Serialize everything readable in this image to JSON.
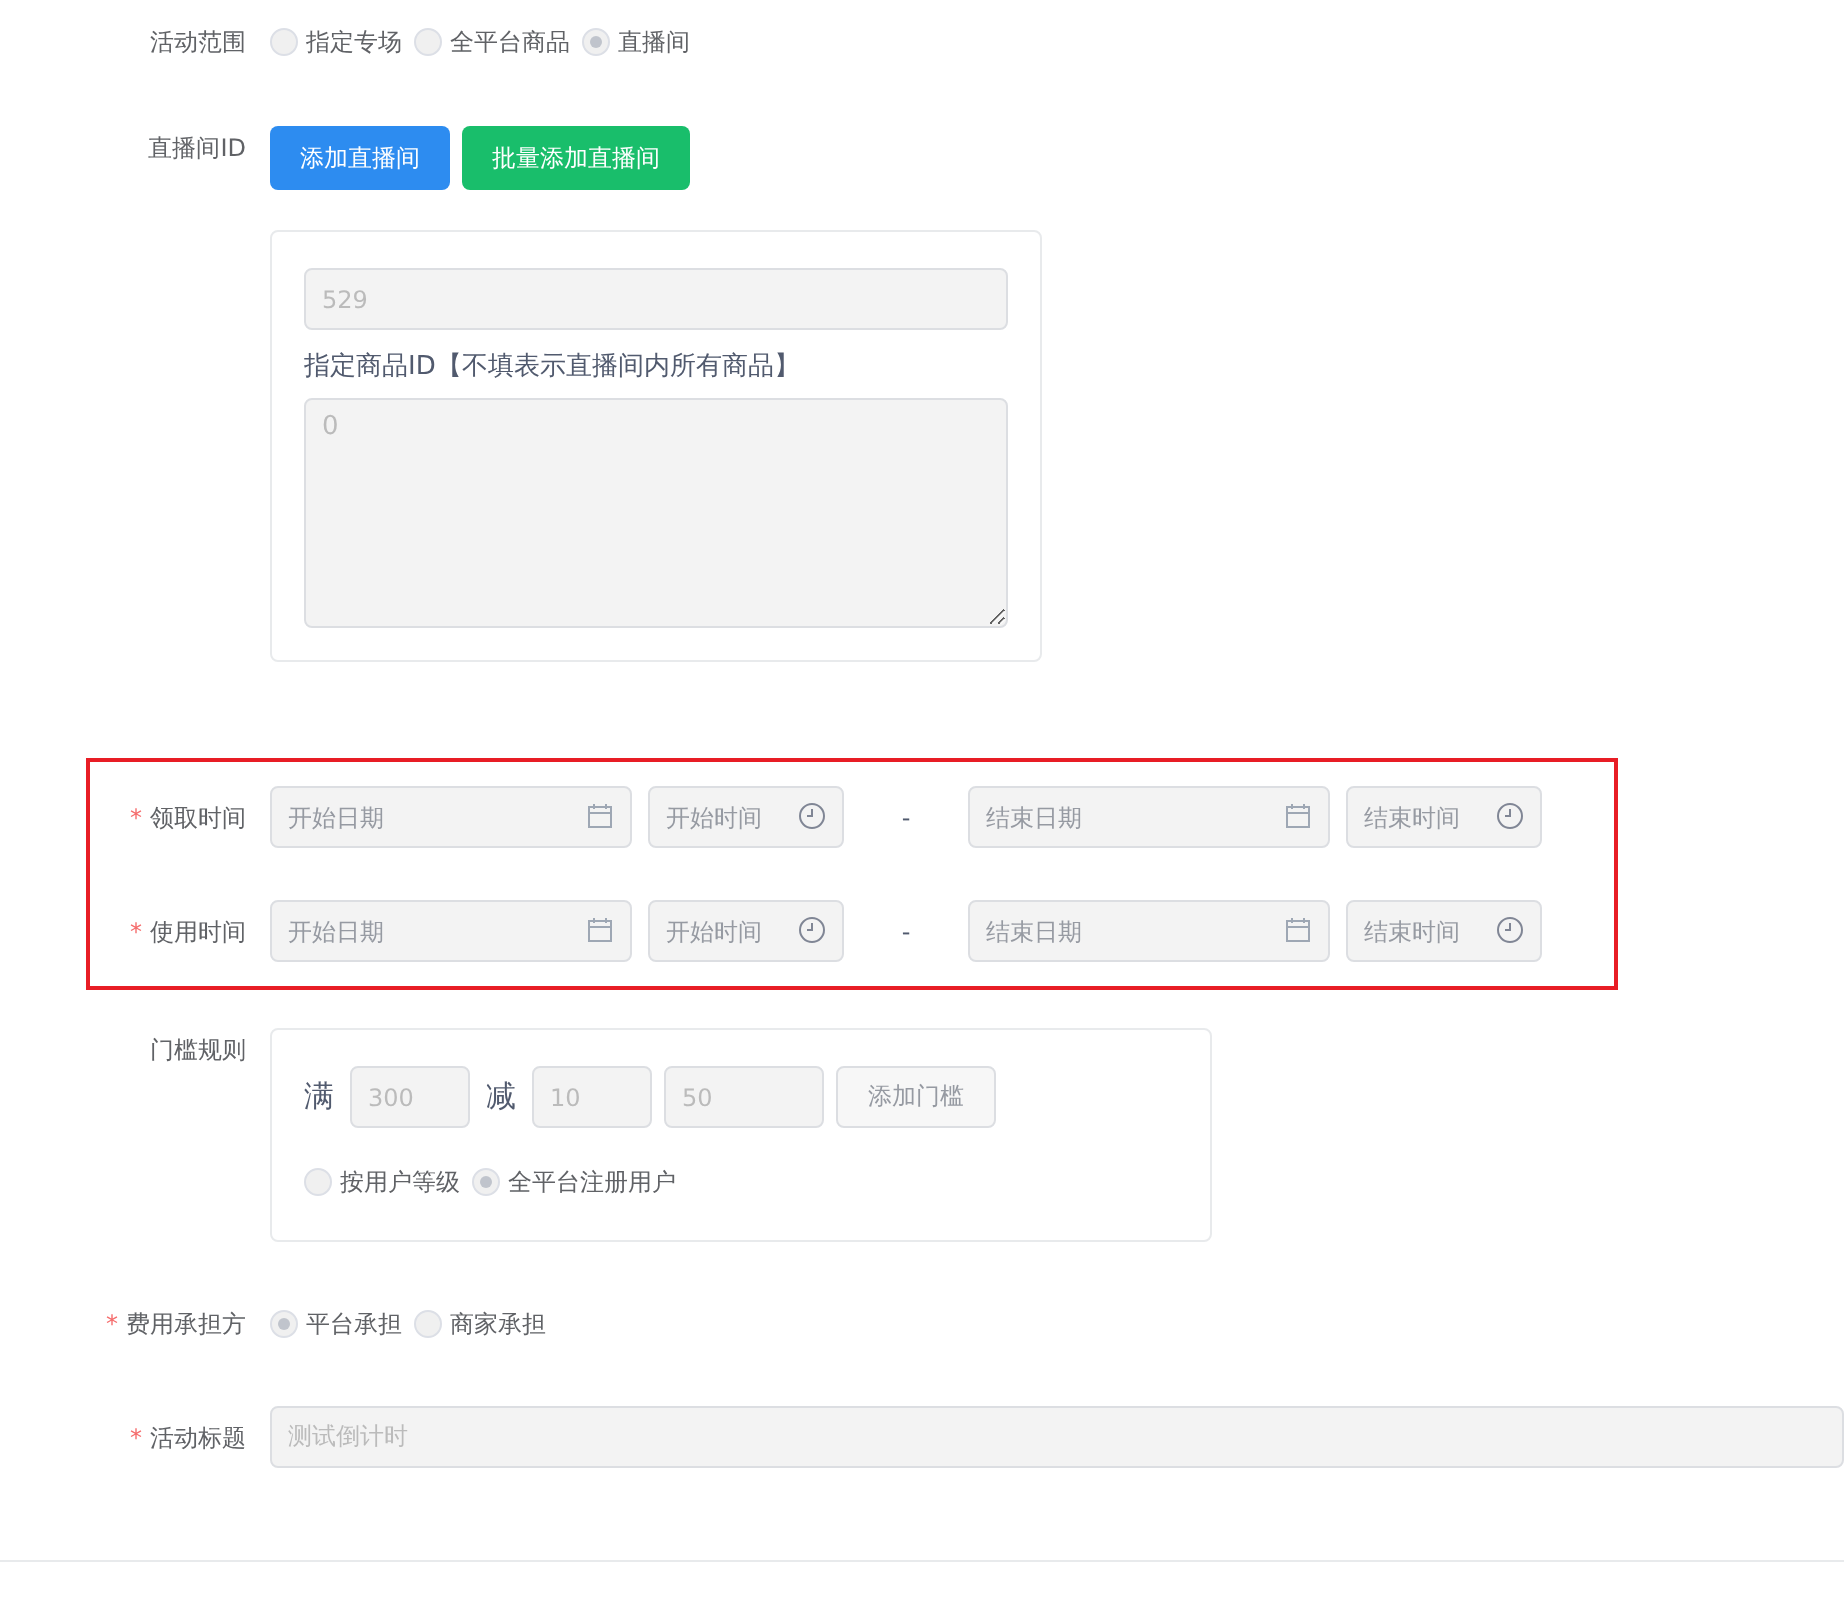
{
  "scope": {
    "label": "活动范围",
    "options": [
      {
        "label": "指定专场",
        "selected": false
      },
      {
        "label": "全平台商品",
        "selected": false
      },
      {
        "label": "直播间",
        "selected": true
      }
    ]
  },
  "live_room": {
    "label": "直播间ID",
    "buttons": [
      {
        "label": "添加直播间",
        "kind": "primary"
      },
      {
        "label": "批量添加直播间",
        "kind": "success"
      }
    ],
    "card": {
      "room_id": {
        "value": "529"
      },
      "goods_label": "指定商品ID【不填表示直播间内所有商品】",
      "goods_ids": {
        "value": "0"
      }
    }
  },
  "time_group": {
    "highlighted": true,
    "rows": [
      {
        "label": "领取时间",
        "required_mark": "*",
        "start_date": {
          "placeholder": "开始日期"
        },
        "start_time": {
          "placeholder": "开始时间"
        },
        "separator": "-",
        "end_date": {
          "placeholder": "结束日期"
        },
        "end_time": {
          "placeholder": "结束时间"
        }
      },
      {
        "label": "使用时间",
        "required_mark": "*",
        "start_date": {
          "placeholder": "开始日期"
        },
        "start_time": {
          "placeholder": "开始时间"
        },
        "separator": "-",
        "end_date": {
          "placeholder": "结束日期"
        },
        "end_time": {
          "placeholder": "结束时间"
        }
      }
    ]
  },
  "threshold": {
    "label": "门槛规则",
    "full_label": "满",
    "full_value": "300",
    "minus_label": "减",
    "minus_value": "10",
    "extra_value": "50",
    "add_button": "添加门槛",
    "user_options": [
      {
        "label": "按用户等级",
        "selected": false
      },
      {
        "label": "全平台注册用户",
        "selected": true
      }
    ]
  },
  "cost_bearer": {
    "label": "费用承担方",
    "required_mark": "*",
    "options": [
      {
        "label": "平台承担",
        "selected": true
      },
      {
        "label": "商家承担",
        "selected": false
      }
    ]
  },
  "title": {
    "label": "活动标题",
    "required_mark": "*",
    "value": "测试倒计时"
  }
}
